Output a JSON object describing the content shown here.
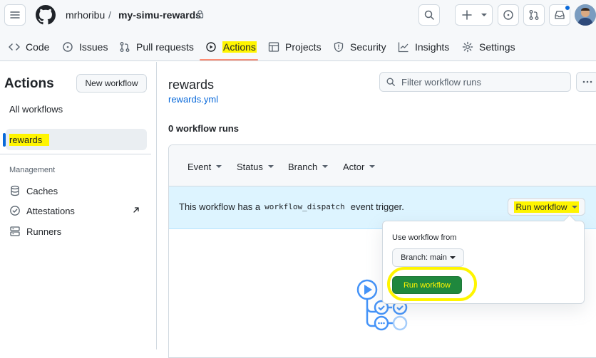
{
  "header": {
    "owner": "mrhoribu",
    "separator": "/",
    "repo": "my-simu-rewards"
  },
  "tabs": [
    {
      "label": "Code",
      "icon": "code-icon"
    },
    {
      "label": "Issues",
      "icon": "issue-icon"
    },
    {
      "label": "Pull requests",
      "icon": "pull-request-icon"
    },
    {
      "label": "Actions",
      "icon": "play-icon",
      "active": true
    },
    {
      "label": "Projects",
      "icon": "table-icon"
    },
    {
      "label": "Security",
      "icon": "shield-icon"
    },
    {
      "label": "Insights",
      "icon": "graph-icon"
    },
    {
      "label": "Settings",
      "icon": "gear-icon"
    }
  ],
  "sidebar": {
    "title": "Actions",
    "new_workflow": "New workflow",
    "all_workflows": "All workflows",
    "selected_workflow": "rewards",
    "management_heading": "Management",
    "management_items": [
      {
        "label": "Caches",
        "icon": "database-icon"
      },
      {
        "label": "Attestations",
        "icon": "verified-icon"
      },
      {
        "label": "Runners",
        "icon": "server-icon"
      }
    ]
  },
  "main": {
    "title": "rewards",
    "file_link": "rewards.yml",
    "filter_placeholder": "Filter workflow runs",
    "run_count": "0 workflow runs",
    "filters": [
      "Event",
      "Status",
      "Branch",
      "Actor"
    ],
    "banner_prefix": "This workflow has a",
    "banner_code": "workflow_dispatch",
    "banner_suffix": "event trigger.",
    "run_workflow_label": "Run workflow"
  },
  "dropdown": {
    "heading": "Use workflow from",
    "branch_label": "Branch: main",
    "submit_label": "Run workflow"
  },
  "colors": {
    "accent_link": "#0969da",
    "highlight": "#fff500",
    "primary_green": "#1f883d",
    "active_tab_underline": "#fd8c73"
  }
}
